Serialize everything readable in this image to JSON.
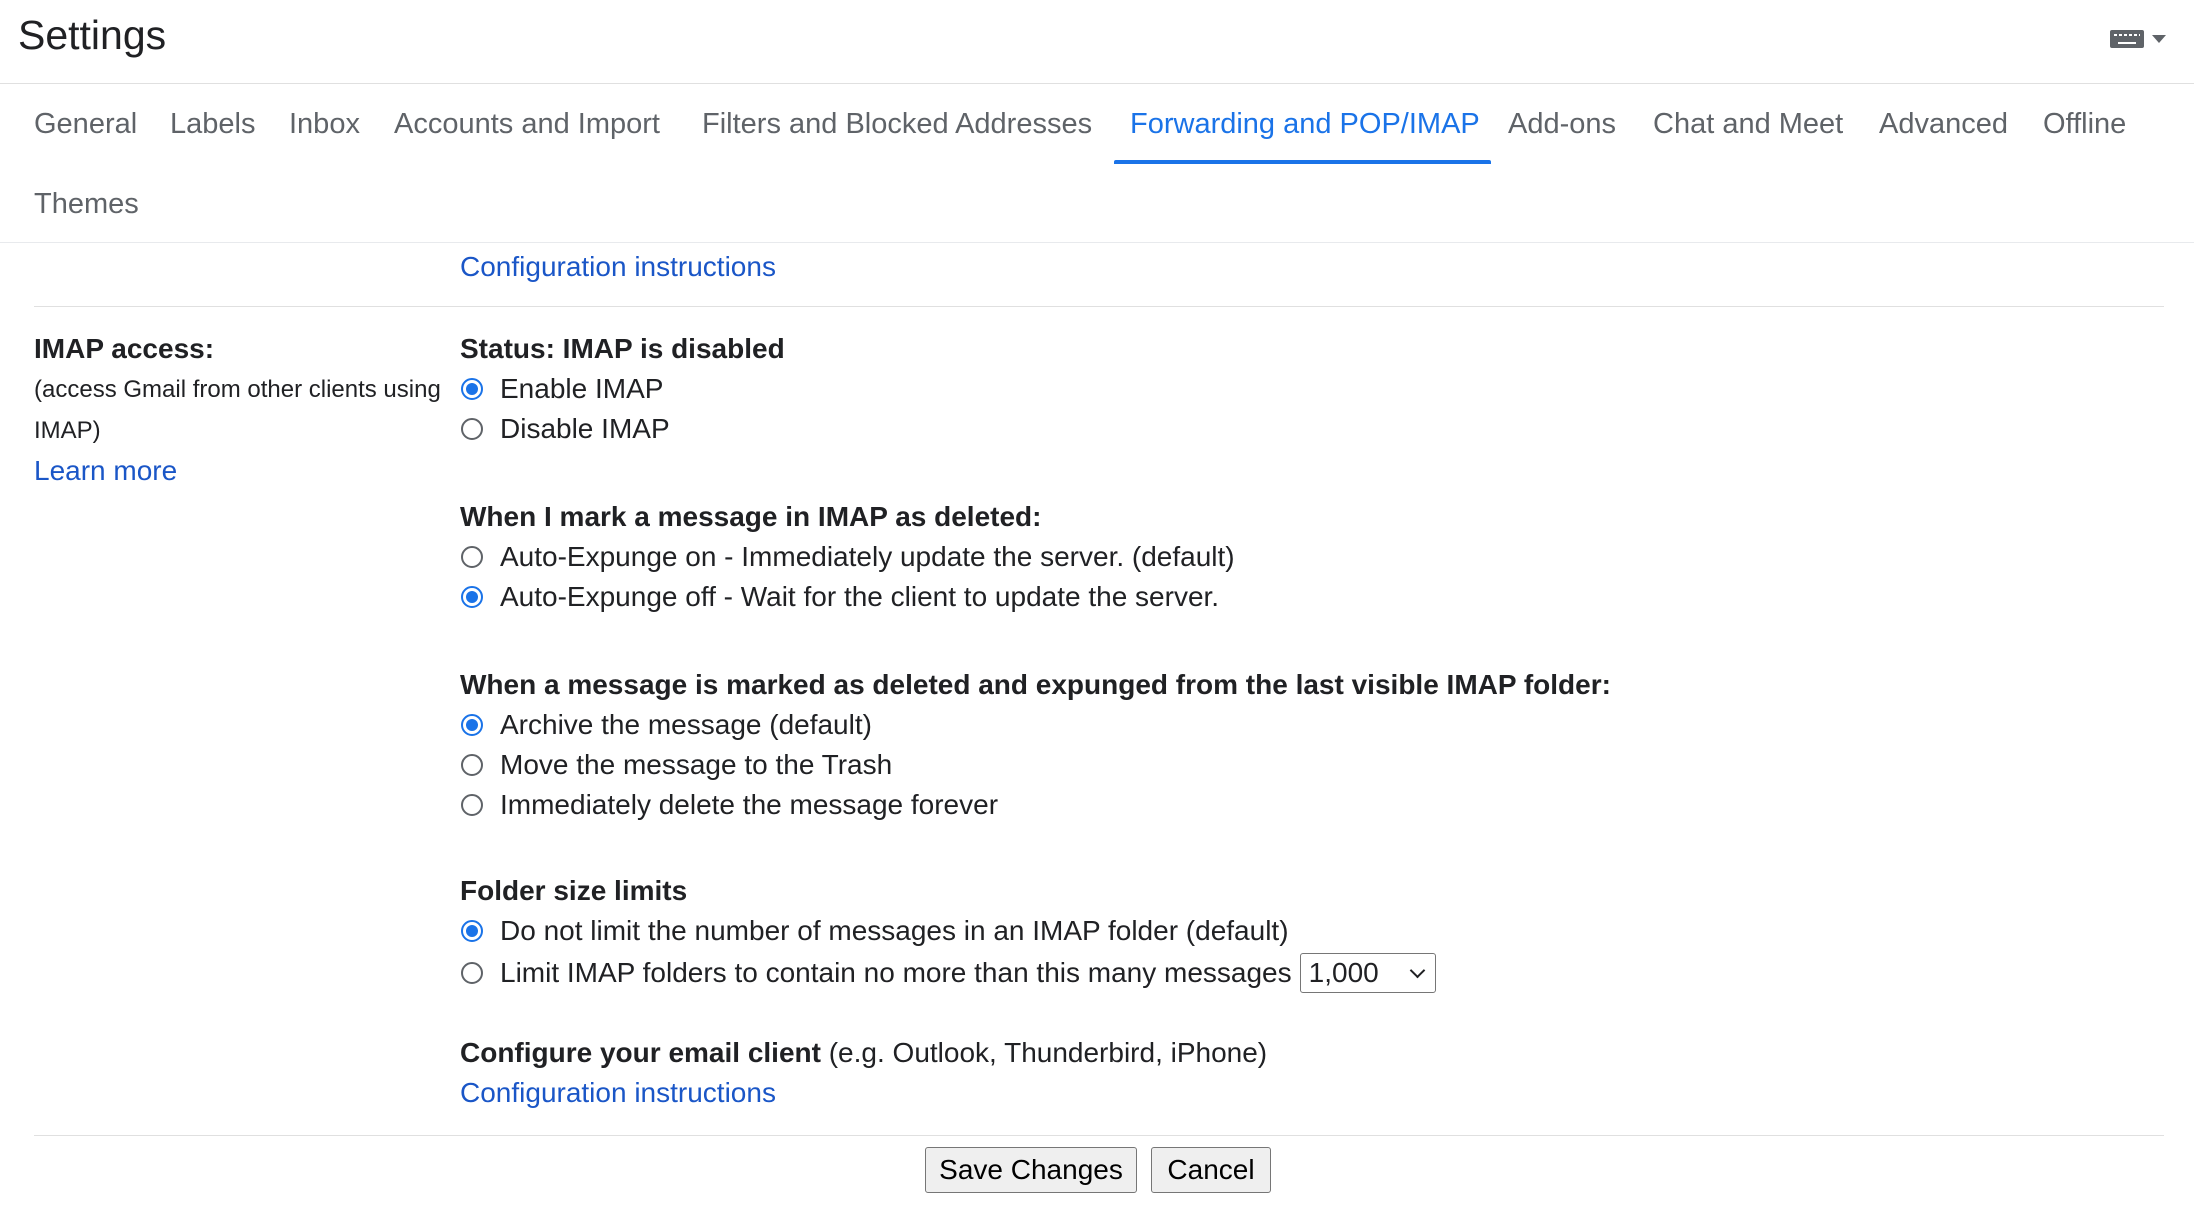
{
  "header": {
    "title": "Settings",
    "input_tools_icon": "keyboard-icon",
    "input_tools_menu_icon": "caret-down-icon"
  },
  "tabs": [
    {
      "label": "General"
    },
    {
      "label": "Labels"
    },
    {
      "label": "Inbox"
    },
    {
      "label": "Accounts and Import"
    },
    {
      "label": "Filters and Blocked Addresses"
    },
    {
      "label": "Forwarding and POP/IMAP",
      "active": true
    },
    {
      "label": "Add-ons"
    },
    {
      "label": "Chat and Meet"
    },
    {
      "label": "Advanced"
    },
    {
      "label": "Offline"
    },
    {
      "label": "Themes"
    }
  ],
  "pop": {
    "config_link": "Configuration instructions"
  },
  "imap": {
    "label_title": "IMAP access:",
    "label_desc": "(access Gmail from other clients using IMAP)",
    "learn_more": "Learn more",
    "status": "Status: IMAP is disabled",
    "enable_option": {
      "label": "Enable IMAP",
      "checked": true
    },
    "disable_option": {
      "label": "Disable IMAP",
      "checked": false
    },
    "deleted": {
      "title": "When I mark a message in IMAP as deleted:",
      "options": [
        {
          "label": "Auto-Expunge on - Immediately update the server. (default)",
          "checked": false
        },
        {
          "label": "Auto-Expunge off - Wait for the client to update the server.",
          "checked": true
        }
      ]
    },
    "expunged": {
      "title": "When a message is marked as deleted and expunged from the last visible IMAP folder:",
      "options": [
        {
          "label": "Archive the message (default)",
          "checked": true
        },
        {
          "label": "Move the message to the Trash",
          "checked": false
        },
        {
          "label": "Immediately delete the message forever",
          "checked": false
        }
      ]
    },
    "folder_limits": {
      "title": "Folder size limits",
      "options": [
        {
          "label": "Do not limit the number of messages in an IMAP folder (default)",
          "checked": true
        },
        {
          "label": "Limit IMAP folders to contain no more than this many messages",
          "checked": false
        }
      ],
      "limit_value": "1,000"
    },
    "client": {
      "title_bold": "Configure your email client",
      "title_rest": " (e.g. Outlook, Thunderbird, iPhone)",
      "config_link": "Configuration instructions"
    }
  },
  "actions": {
    "save_label": "Save Changes",
    "cancel_label": "Cancel"
  },
  "colors": {
    "accent": "#1a73e8",
    "link": "#1a56c7",
    "text": "#202124",
    "tab_text": "#5f6368"
  }
}
